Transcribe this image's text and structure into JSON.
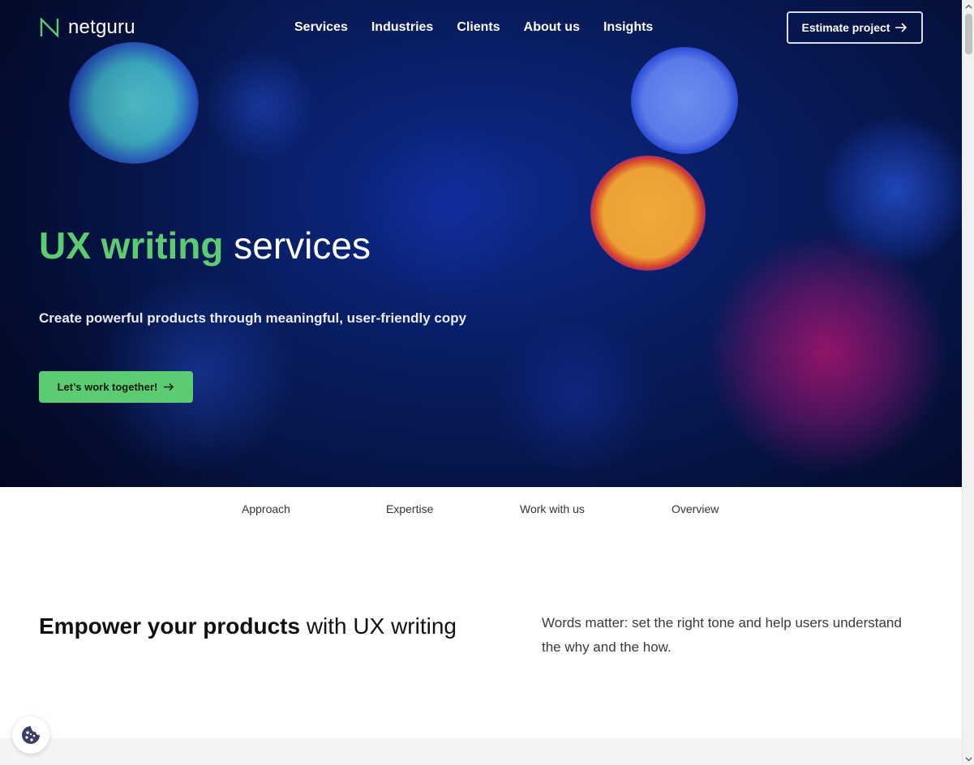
{
  "header": {
    "logo_text": "netguru",
    "logo_icon": "netguru-n-logo-icon",
    "nav": [
      {
        "label": "Services"
      },
      {
        "label": "Industries"
      },
      {
        "label": "Clients"
      },
      {
        "label": "About us"
      },
      {
        "label": "Insights"
      }
    ],
    "estimate_button": {
      "label": "Estimate project",
      "icon": "arrow-right-icon"
    }
  },
  "hero": {
    "title_accent": "UX writing",
    "title_rest": " services",
    "subtitle": "Create powerful products through meaningful, user-friendly copy",
    "cta": {
      "label": "Let’s work together!",
      "icon": "arrow-right-icon"
    }
  },
  "tabs": [
    {
      "label": "Approach"
    },
    {
      "label": "Expertise"
    },
    {
      "label": "Work with us"
    },
    {
      "label": "Overview"
    }
  ],
  "section": {
    "title_bold": "Empower your products",
    "title_rest": " with UX writing",
    "text": "Words matter: set the right tone and help users under­stand the why and the how."
  },
  "cookie_button": {
    "icon": "cookie-icon"
  },
  "colors": {
    "accent_green": "#5ccc72",
    "hero_navy": "#081b5c",
    "text_dark": "#111111"
  }
}
